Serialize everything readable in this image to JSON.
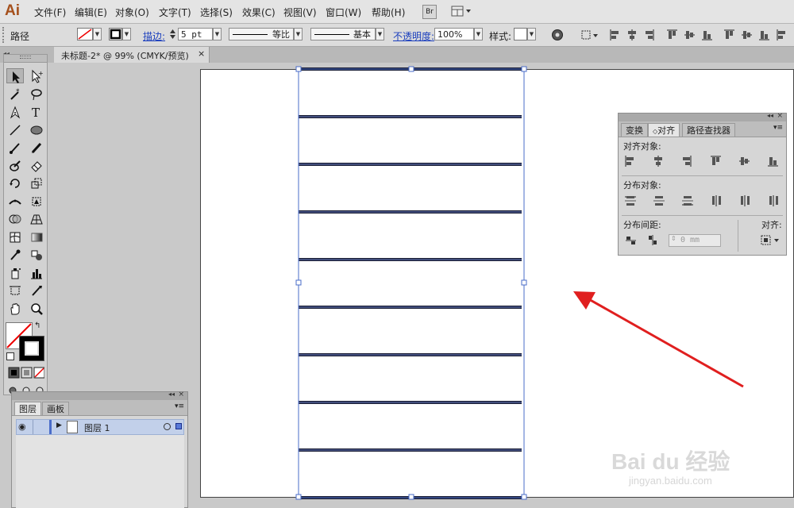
{
  "app": {
    "logo": "Ai"
  },
  "menu": [
    "文件(F)",
    "编辑(E)",
    "对象(O)",
    "文字(T)",
    "选择(S)",
    "效果(C)",
    "视图(V)",
    "窗口(W)",
    "帮助(H)"
  ],
  "bridge_label": "Br",
  "control_bar": {
    "object_type": "路径",
    "stroke_label": "描边:",
    "stroke_weight": "5 pt",
    "profile_label": "等比",
    "brush_label": "基本",
    "opacity_label": "不透明度:",
    "opacity_value": "100%",
    "style_label": "样式:"
  },
  "document_tab": {
    "title": "未标题-2* @ 99% (CMYK/预览)",
    "close": "×"
  },
  "align_panel": {
    "tabs": [
      "变换",
      "对齐",
      "路径查找器"
    ],
    "active_tab": "对齐",
    "align_objects": "对齐对象:",
    "distribute_objects": "分布对象:",
    "distribute_spacing": "分布间距:",
    "align_to": "对齐:",
    "spacing_value": "0 mm"
  },
  "layers_panel": {
    "tabs": [
      "图层",
      "画板"
    ],
    "active_tab": "图层",
    "layers": [
      {
        "name": "图层 1"
      }
    ]
  },
  "watermark": {
    "brand": "Bai du 经验",
    "url": "jingyan.baidu.com"
  },
  "colors": {
    "arrow": "#e01f1f",
    "selection": "#4a6cc9",
    "line": "#1b1f36",
    "link": "#1a3ebd"
  }
}
